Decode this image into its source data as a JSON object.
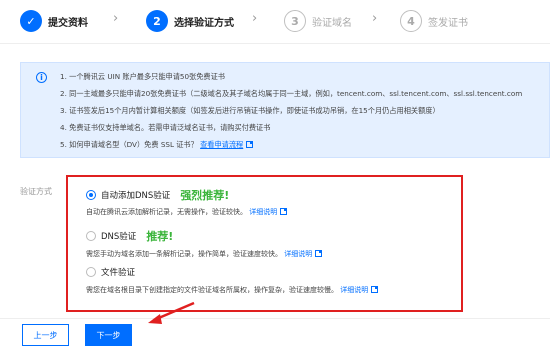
{
  "steps": [
    {
      "num": "✓",
      "label": "提交资料",
      "state": "done"
    },
    {
      "num": "2",
      "label": "选择验证方式",
      "state": "active"
    },
    {
      "num": "3",
      "label": "验证域名",
      "state": "todo"
    },
    {
      "num": "4",
      "label": "签发证书",
      "state": "todo"
    }
  ],
  "info": {
    "lines": [
      "1. 一个腾讯云 UIN 账户最多只能申请50张免费证书",
      "2. 同一主域最多只能申请20张免费证书（二级域名及其子域名均属于同一主域，例如，tencent.com、ssl.tencent.com、ssl.ssl.tencent.com",
      "3. 证书签发后15个月内暂计算相关额度（如签发后进行吊销证书操作，即使证书成功吊销，在15个月仍占用相关额度）",
      "4. 免费证书仅支持单域名。若需申请泛域名证书，请购买付费证书"
    ],
    "line5_text": "5. 如何申请域名型（DV）免费 SSL 证书？",
    "line5_link": "查看申请流程"
  },
  "method": {
    "label": "验证方式",
    "options": [
      {
        "label": "自动添加DNS验证",
        "recommend": "强烈推荐!",
        "desc": "自动在腾讯云添加解析记录，无需操作，验证较快。",
        "link": "详细说明",
        "checked": true
      },
      {
        "label": "DNS验证",
        "recommend": "推荐!",
        "desc": "需您手动为域名添加一条解析记录，操作简单，验证速度较快。",
        "link": "详细说明",
        "checked": false
      },
      {
        "label": "文件验证",
        "recommend": "",
        "desc": "需您在域名根目录下创建指定的文件验证域名所属权，操作复杂，验证速度较慢。",
        "link": "详细说明",
        "checked": false
      }
    ]
  },
  "footer": {
    "prev_label": "上一步",
    "next_label": "下一步"
  },
  "colors": {
    "accent": "#006eff",
    "highlight": "#e02020",
    "recommend": "#3cb53c"
  }
}
